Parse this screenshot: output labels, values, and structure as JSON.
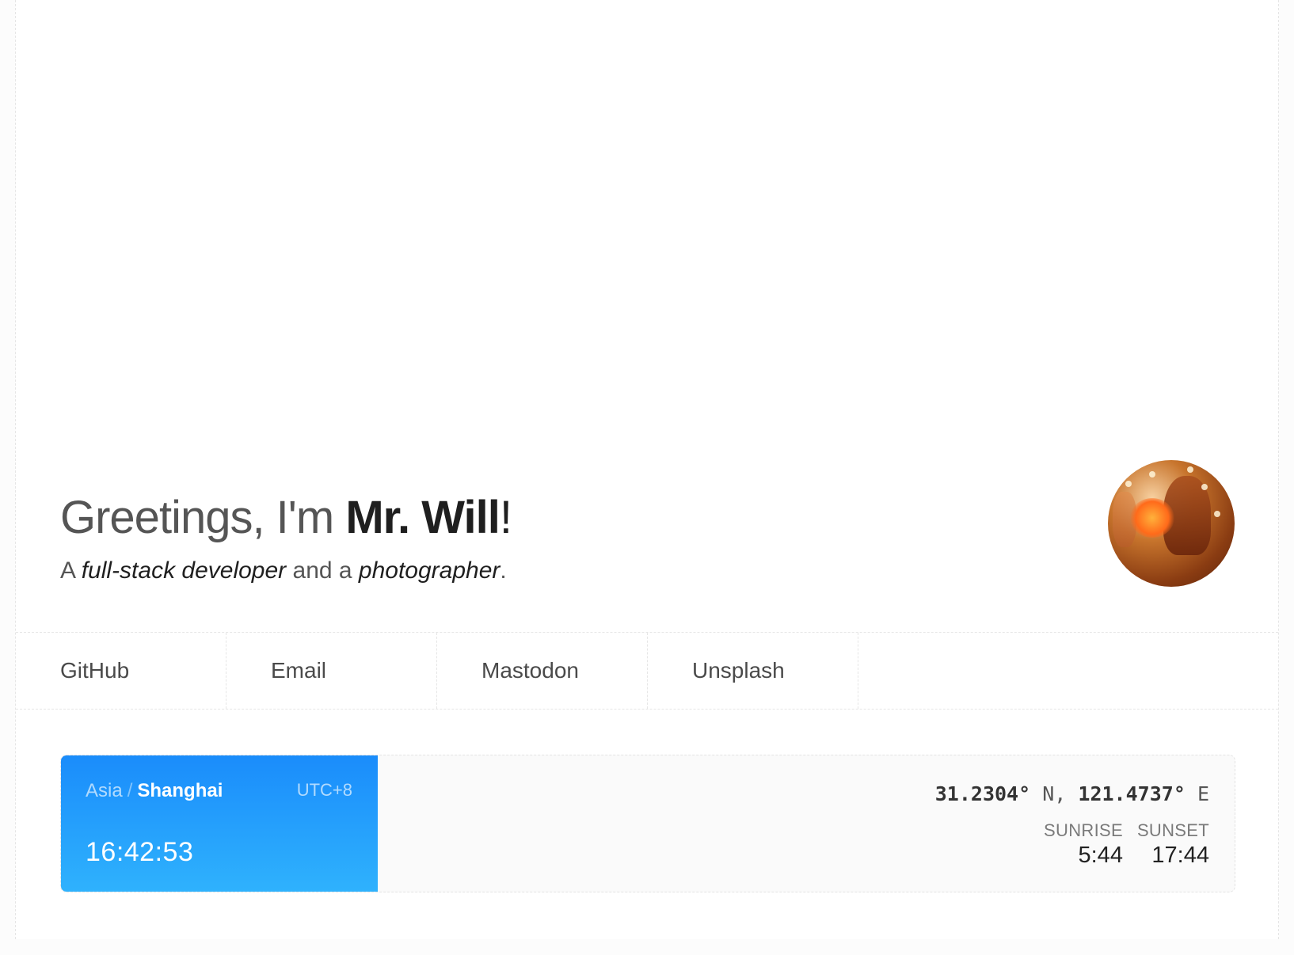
{
  "hero": {
    "greeting_prefix": "Greetings, I'm ",
    "name": "Mr. Will",
    "greeting_suffix": "!",
    "tagline": {
      "prefix": "A ",
      "role1": "full-stack developer",
      "middle": " and a ",
      "role2": "photographer",
      "suffix": "."
    }
  },
  "links": [
    {
      "label": "GitHub"
    },
    {
      "label": "Email"
    },
    {
      "label": "Mastodon"
    },
    {
      "label": "Unsplash"
    }
  ],
  "location": {
    "region": "Asia",
    "separator": "/",
    "city": "Shanghai",
    "utc_offset": "UTC+8",
    "time": "16:42:53",
    "latitude": "31.2304°",
    "lat_dir": "N,",
    "longitude": "121.4737°",
    "lon_dir": "E",
    "sunrise_label": "SUNRISE",
    "sunrise": "5:44",
    "sunset_label": "SUNSET",
    "sunset": "17:44"
  },
  "colors": {
    "accent_gradient_top": "#1a8cfb",
    "accent_gradient_bottom": "#2fb2fd"
  }
}
